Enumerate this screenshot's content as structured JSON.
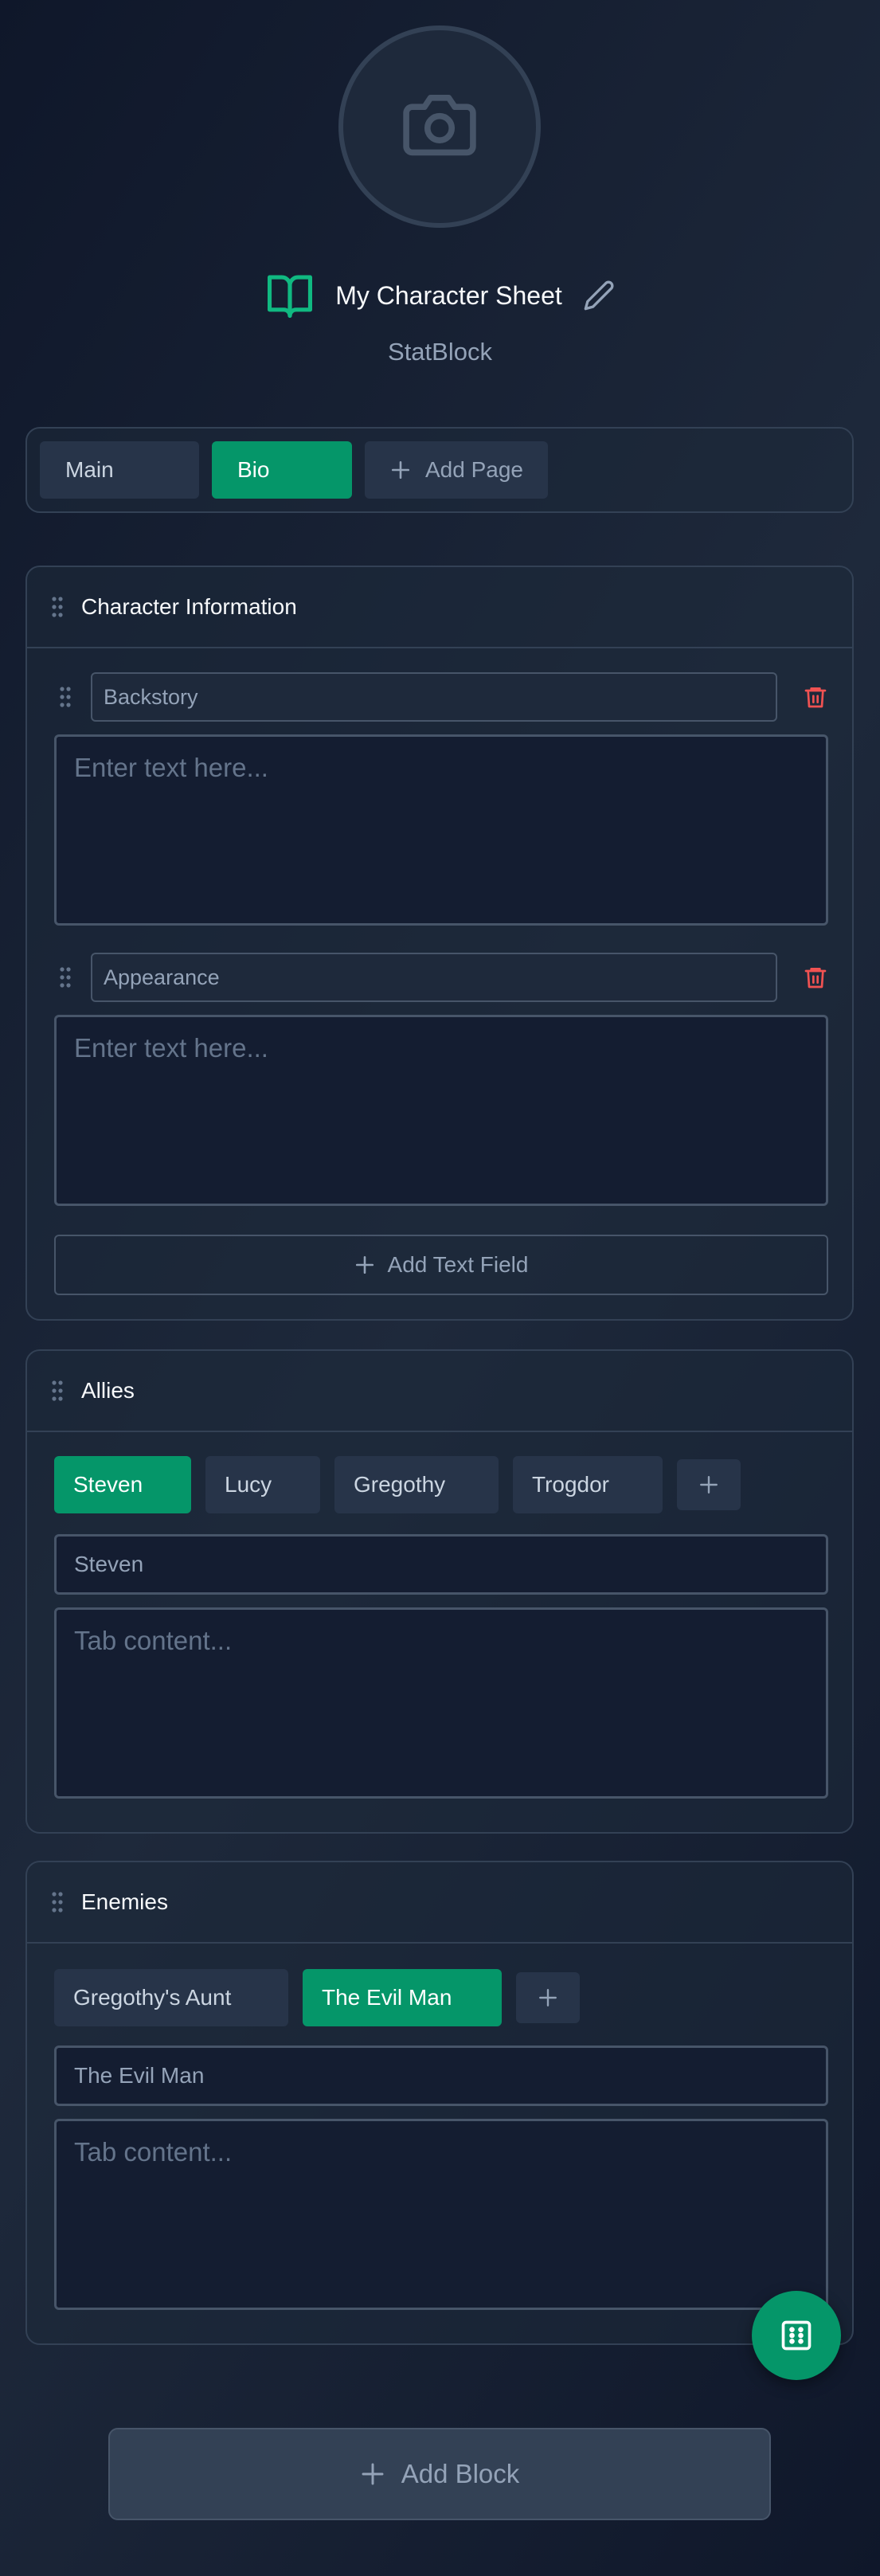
{
  "header": {
    "avatar_icon": "camera-icon",
    "title_icon": "book-open-icon",
    "title": "My Character Sheet",
    "edit_icon": "pencil-icon",
    "subtitle": "StatBlock"
  },
  "pages": {
    "tabs": [
      {
        "label": "Main",
        "active": false
      },
      {
        "label": "Bio",
        "active": true
      }
    ],
    "add_label": "Add Page"
  },
  "character_info": {
    "title": "Character Information",
    "fields": [
      {
        "title": "Backstory",
        "placeholder": "Enter text here..."
      },
      {
        "title": "Appearance",
        "placeholder": "Enter text here..."
      }
    ],
    "add_field_label": "Add Text Field"
  },
  "allies": {
    "title": "Allies",
    "tabs": [
      "Steven",
      "Lucy",
      "Gregothy",
      "Trogdor"
    ],
    "active_tab": "Steven",
    "tab_name_value": "Steven",
    "content_placeholder": "Tab content..."
  },
  "enemies": {
    "title": "Enemies",
    "tabs": [
      "Gregothy's Aunt",
      "The Evil Man"
    ],
    "active_tab": "The Evil Man",
    "tab_name_value": "The Evil Man",
    "content_placeholder": "Tab content..."
  },
  "actions": {
    "add_block_label": "Add Block",
    "fab_icon": "dice-icon"
  },
  "colors": {
    "accent": "#059669",
    "danger": "#f05252",
    "background": "#0f172a",
    "panel_border": "#334155"
  }
}
